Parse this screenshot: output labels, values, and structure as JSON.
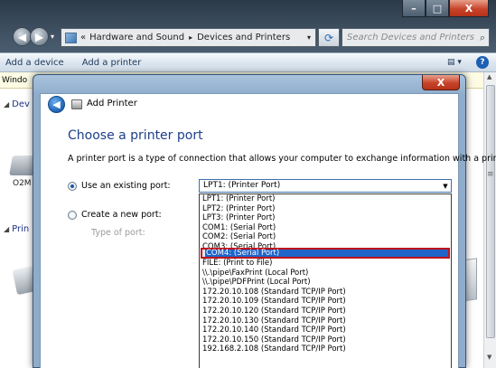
{
  "explorer": {
    "window_controls": {
      "minimize": "–",
      "maximize": "□",
      "close": "X"
    },
    "address": {
      "root": "«",
      "crumb1": "Hardware and Sound",
      "crumb2": "Devices and Printers"
    },
    "search_placeholder": "Search Devices and Printers",
    "commands": {
      "add_device": "Add a device",
      "add_printer": "Add a printer"
    },
    "info_strip": "Windo",
    "groups": {
      "devices": "Dev",
      "printers": "Prin"
    },
    "device_label": "O2M",
    "arrows": {
      "separator": "▸",
      "dropdown": "▾",
      "back": "◀",
      "forward": "▶",
      "refresh": "⟳",
      "search": "⌕",
      "help": "?",
      "view": "▤ ▾",
      "group_tri": "◢",
      "scroll_up": "▲",
      "scroll_down": "▼",
      "grip": "≡",
      "info_close": "x"
    }
  },
  "dialog": {
    "close_label": "X",
    "title": "Add Printer",
    "back_glyph": "◀",
    "heading": "Choose a printer port",
    "intro": "A printer port is a type of connection that allows your computer to exchange information with a printer.",
    "existing_port_label": "Use an existing port:",
    "new_port_label": "Create a new port:",
    "type_of_port_label": "Type of port:",
    "combo_value": "LPT1: (Printer Port)",
    "combo_arrow": "▼",
    "port_options": [
      "LPT1: (Printer Port)",
      "LPT2: (Printer Port)",
      "LPT3: (Printer Port)",
      "COM1: (Serial Port)",
      "COM2: (Serial Port)",
      "COM3: (Serial Port)",
      "COM4: (Serial Port)",
      "FILE: (Print to File)",
      "\\\\.\\pipe\\FaxPrint (Local Port)",
      "\\\\.\\pipe\\PDFPrint (Local Port)",
      "172.20.10.108 (Standard TCP/IP Port)",
      "172.20.10.109 (Standard TCP/IP Port)",
      "172.20.10.120 (Standard TCP/IP Port)",
      "172.20.10.130 (Standard TCP/IP Port)",
      "172.20.10.140 (Standard TCP/IP Port)",
      "172.20.10.150 (Standard TCP/IP Port)",
      "192.168.2.108 (Standard TCP/IP Port)"
    ],
    "selected_option": "COM4: (Serial Port)"
  },
  "colors": {
    "accent": "#1f64c9",
    "highlight_border": "#c0131b",
    "heading": "#1e3f8a",
    "close_red": "#c7442a"
  }
}
